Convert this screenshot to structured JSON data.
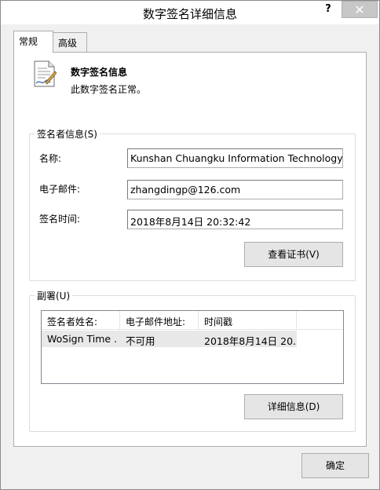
{
  "window": {
    "title": "数字签名详细信息",
    "help": "?",
    "close": "✕"
  },
  "tabs": [
    {
      "label": "常规",
      "selected": true
    },
    {
      "label": "高级",
      "selected": false
    }
  ],
  "info": {
    "title": "数字签名信息",
    "status": "此数字签名正常。"
  },
  "signer": {
    "group_label": "签名者信息(S)",
    "name_label": "名称:",
    "name_value": "Kunshan Chuangku Information Technology Co",
    "email_label": "电子邮件:",
    "email_value": "zhangdingp@126.com",
    "time_label": "签名时间:",
    "time_value": "2018年8月14日 20:32:42",
    "view_cert_button": "查看证书(V)"
  },
  "countersign": {
    "group_label": "副署(U)",
    "columns": [
      "签名者姓名:",
      "电子邮件地址:",
      "时间戳"
    ],
    "rows": [
      {
        "name": "WoSign Time ...",
        "email": "不可用",
        "timestamp": "2018年8月14日 20..."
      }
    ],
    "details_button": "详细信息(D)"
  },
  "footer": {
    "ok_button": "确定"
  }
}
